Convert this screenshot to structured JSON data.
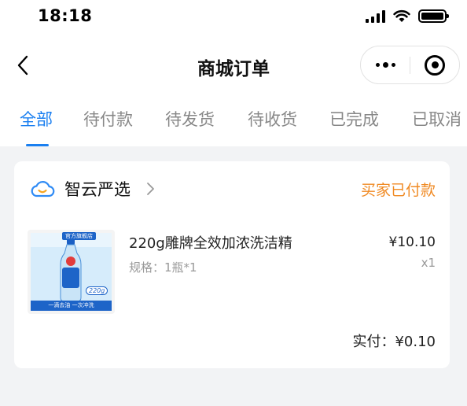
{
  "status_bar": {
    "time": "18:18"
  },
  "nav": {
    "title": "商城订单",
    "icons": [
      "back-icon",
      "more-icon",
      "target-icon"
    ]
  },
  "tabs": [
    {
      "label": "全部",
      "active": true
    },
    {
      "label": "待付款",
      "active": false
    },
    {
      "label": "待发货",
      "active": false
    },
    {
      "label": "待收货",
      "active": false
    },
    {
      "label": "已完成",
      "active": false
    },
    {
      "label": "已取消",
      "active": false
    }
  ],
  "order": {
    "shop_name": "智云严选",
    "status": "买家已付款",
    "product": {
      "name": "220g雕牌全效加浓洗洁精",
      "spec": "规格：1瓶*1",
      "price": "¥10.10",
      "quantity": "x1",
      "image": {
        "tag": "官方旗舰店",
        "size": "220g",
        "slogan": "一滴去油 一次冲洗"
      }
    },
    "paid_label": "实付：",
    "paid_amount": "¥0.10"
  },
  "colors": {
    "accent": "#1a7ff0",
    "status": "#f08a23",
    "background": "#f2f3f5"
  }
}
